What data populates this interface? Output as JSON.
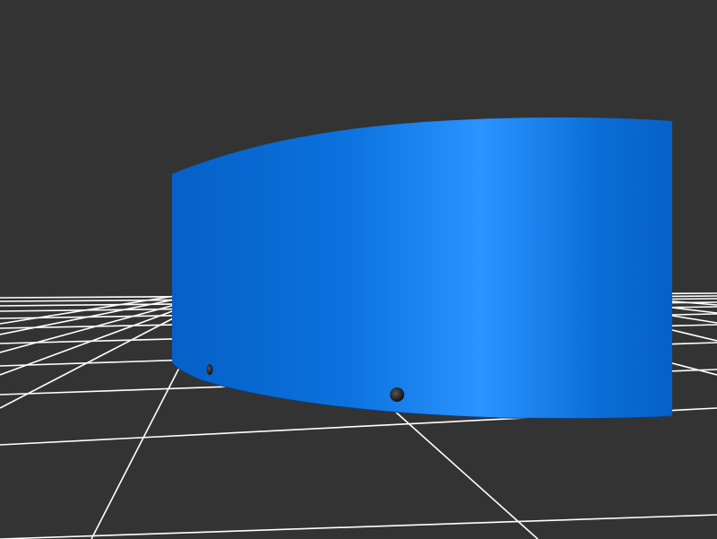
{
  "scene": {
    "background_color": "#333333",
    "grid": {
      "visible": true,
      "line_color": "#ffffff"
    },
    "object": {
      "shape": "curved-panel",
      "color_dark": "#0660c8",
      "color_mid": "#0b72de",
      "color_light": "#2a94ff",
      "holes": 2,
      "hole_color": "#1c1c1c"
    }
  }
}
